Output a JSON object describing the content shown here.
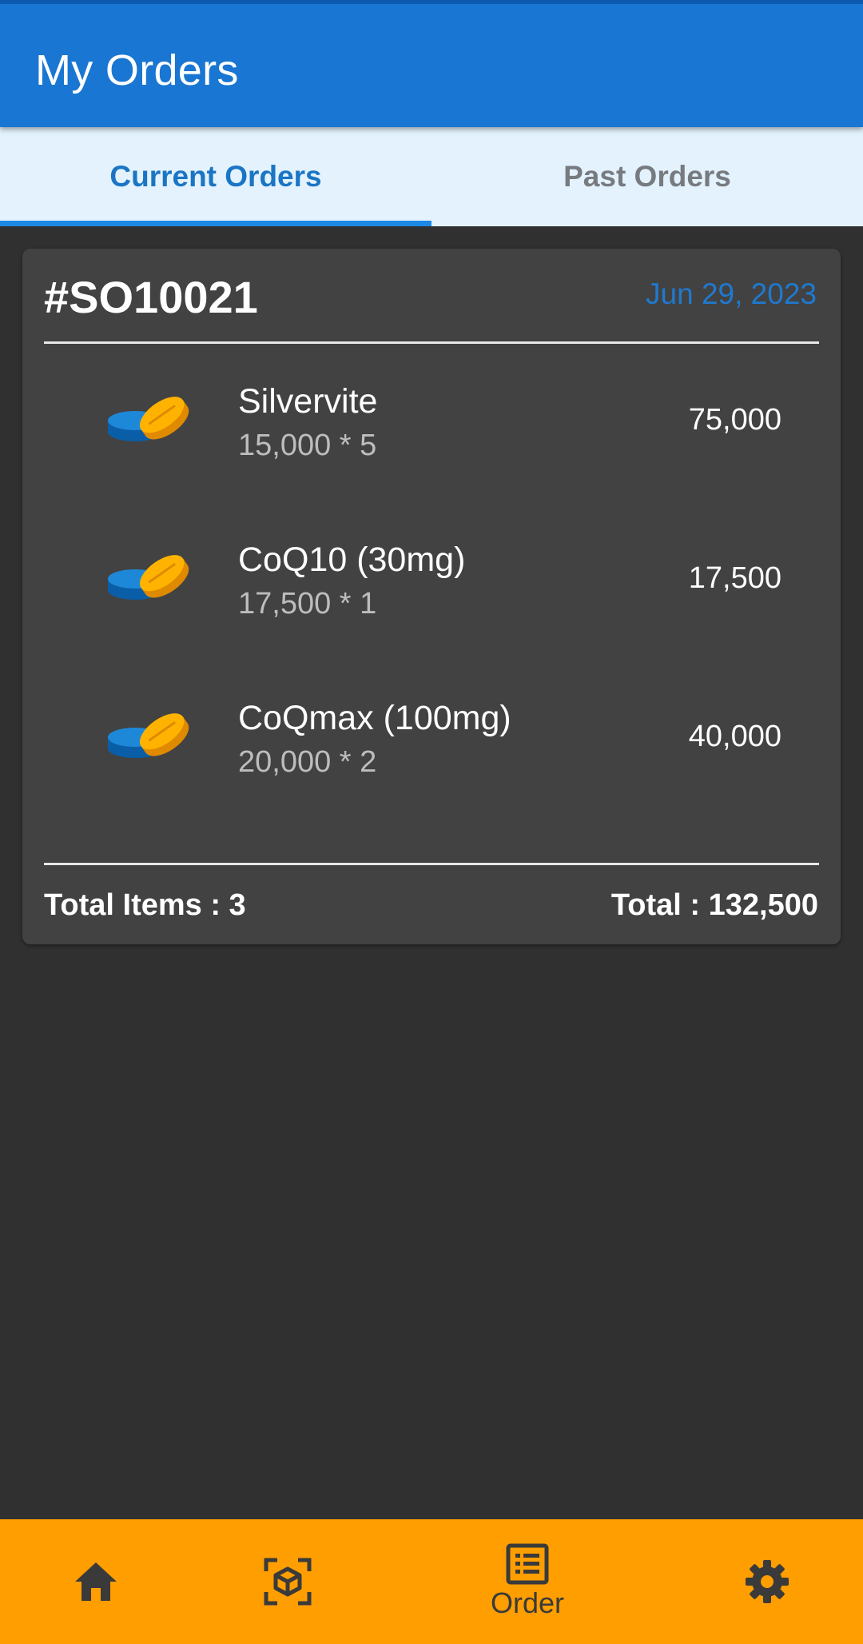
{
  "appbar": {
    "title": "My Orders"
  },
  "tabs": [
    {
      "label": "Current Orders",
      "selected": true
    },
    {
      "label": "Past Orders",
      "selected": false
    }
  ],
  "order": {
    "id": "#SO10021",
    "date": "Jun 29, 2023",
    "items": [
      {
        "name": "Silvervite",
        "qty_line": "15,000 * 5",
        "total": "75,000",
        "icon": "pills-icon"
      },
      {
        "name": "CoQ10 (30mg)",
        "qty_line": "17,500 * 1",
        "total": "17,500",
        "icon": "pills-icon"
      },
      {
        "name": "CoQmax (100mg)",
        "qty_line": "20,000 * 2",
        "total": "40,000",
        "icon": "pills-icon"
      }
    ],
    "total_items": "Total Items : 3",
    "total": "Total : 132,500"
  },
  "bottom_nav": [
    {
      "icon": "home-icon",
      "label": ""
    },
    {
      "icon": "product-scan-icon",
      "label": ""
    },
    {
      "icon": "order-list-icon",
      "label": "Order",
      "active": true
    },
    {
      "icon": "settings-gear-icon",
      "label": ""
    }
  ],
  "colors": {
    "appbar": "#1976d2",
    "tab_bar": "#e3f2fd",
    "tab_indicator": "#1e88e5",
    "background": "#303030",
    "card": "#424242",
    "date_accent": "#1f79cf",
    "bottom_nav": "#ff9e00"
  }
}
